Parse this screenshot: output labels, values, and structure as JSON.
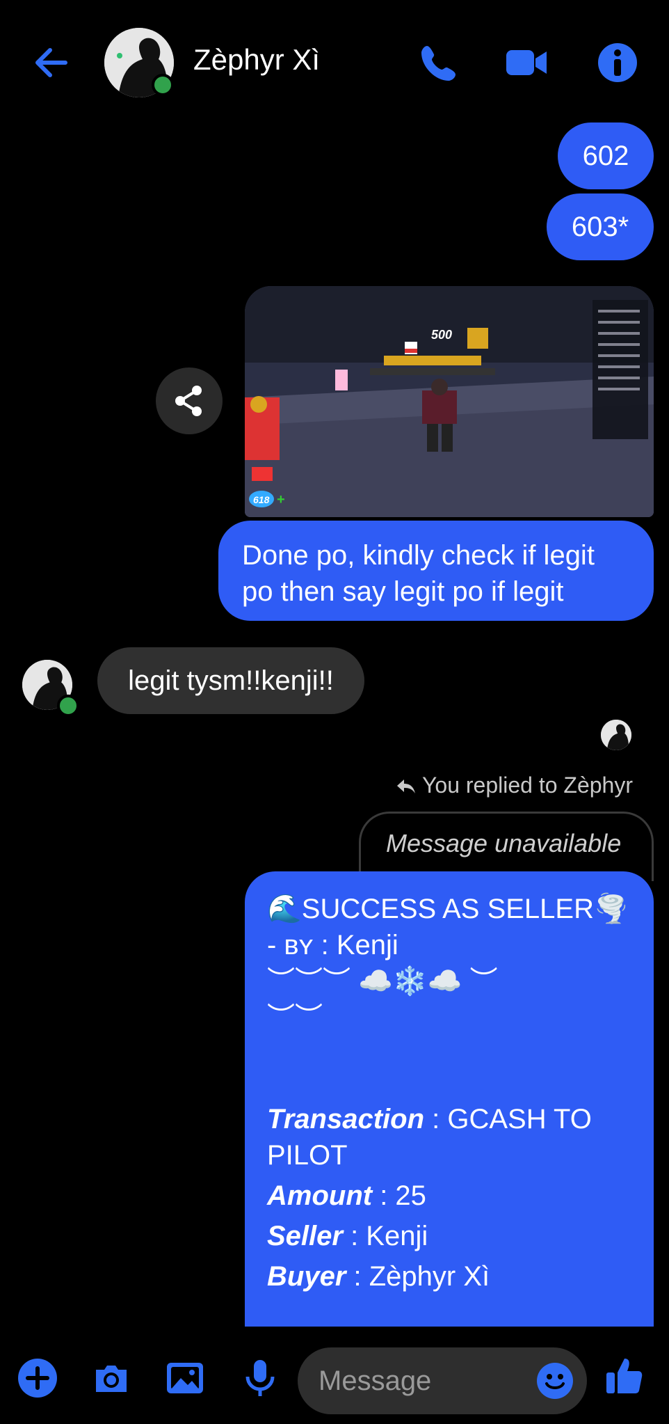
{
  "header": {
    "contact_name": "Zèphyr Xì"
  },
  "messages": {
    "out_602": "602",
    "out_603": "603*",
    "screenshot_score": "500",
    "screenshot_coins": "618",
    "out_done": "Done po, kindly check if legit po then say legit po if legit",
    "in_legit": "legit tysm!!kenji!!",
    "reply_note": "You replied to Zèphyr",
    "reply_quote": "Message unavailable"
  },
  "card": {
    "line1": "🌊SUCCESS AS SELLER🌪️",
    "line2_prefix": "- ʙʏ : ",
    "line2_name": "Kenji",
    "line3": "︶︶︶ ☁️❄️☁️ ︶",
    "line4": "︶︶",
    "transaction_label": "Transaction",
    "transaction_value": " : GCASH TO PILOT",
    "amount_label": "Amount",
    "amount_value": " : 25",
    "seller_label": "Seller",
    "seller_value": " : Kenji",
    "buyer_label": "Buyer",
    "buyer_value": " : Zèphyr Xì"
  },
  "composer": {
    "placeholder": "Message"
  },
  "colors": {
    "accent": "#2f5cf5",
    "incoming": "#303030",
    "online": "#31a24c"
  }
}
